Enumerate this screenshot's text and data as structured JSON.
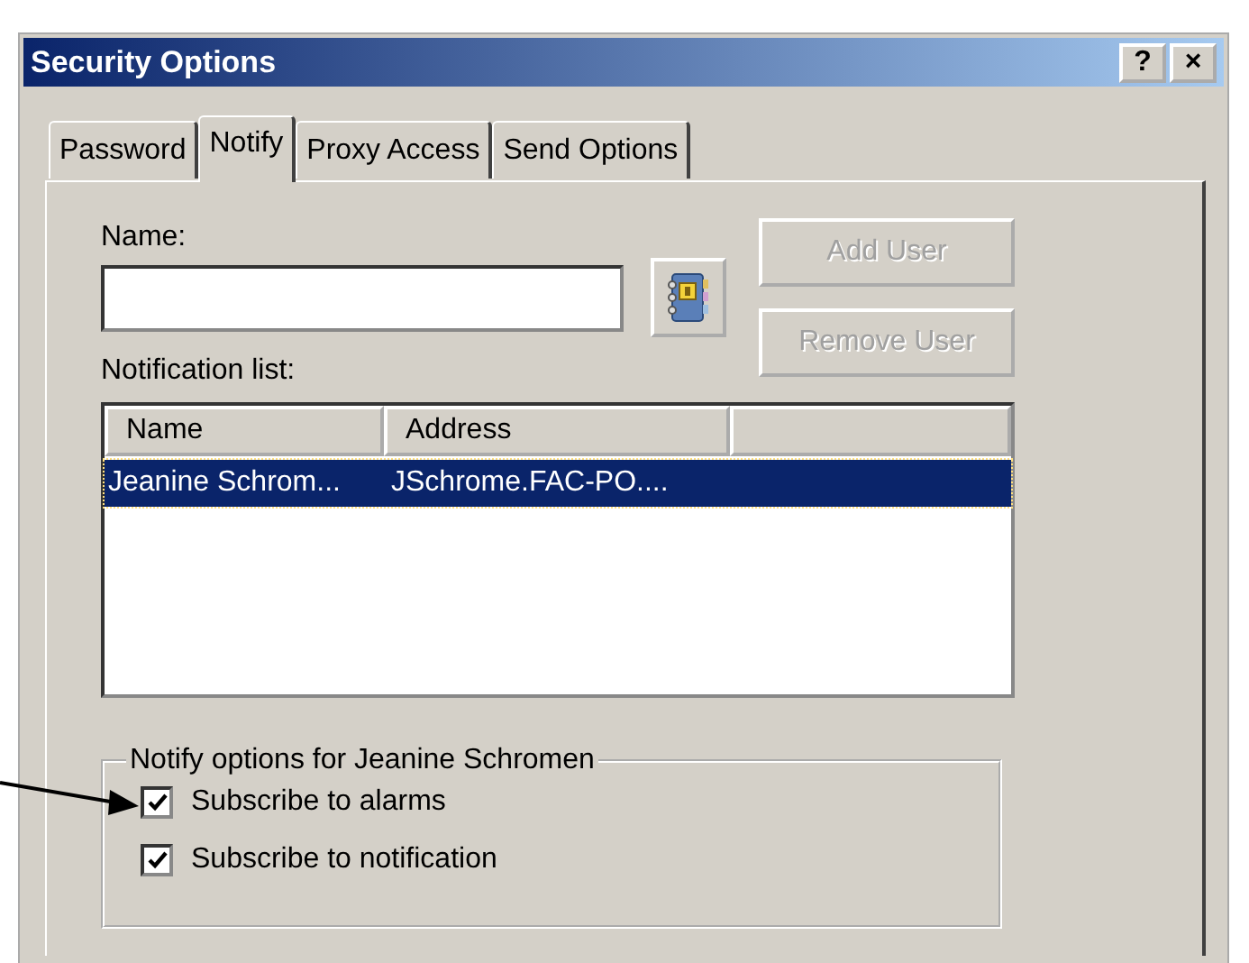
{
  "window": {
    "title": "Security Options",
    "help_button": "?",
    "close_button": "×"
  },
  "tabs": [
    {
      "label": "Password",
      "selected": false
    },
    {
      "label": "Notify",
      "selected": true
    },
    {
      "label": "Proxy Access",
      "selected": false
    },
    {
      "label": "Send Options",
      "selected": false
    }
  ],
  "name_field": {
    "label": "Name:"
  },
  "buttons": [
    {
      "label": "Add User",
      "disabled": true
    },
    {
      "label": "Remove User",
      "disabled": true
    }
  ],
  "notification_list": {
    "label": "Notification list:",
    "columns": [
      "Name",
      "Address"
    ],
    "rows": [
      {
        "cells": [
          "Jeanine Schrom...",
          "JSchrome.FAC-PO...."
        ],
        "selected": true
      }
    ]
  },
  "options_group": {
    "title": "Notify options for Jeanine Schromen",
    "options": [
      {
        "label": "Subscribe to alarms",
        "checked": true
      },
      {
        "label": "Subscribe to notification",
        "checked": true
      }
    ]
  }
}
